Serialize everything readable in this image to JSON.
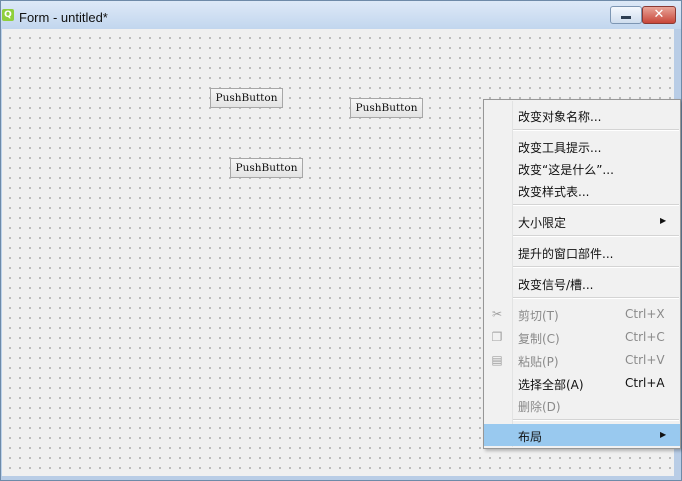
{
  "window": {
    "title": "Form - untitled*",
    "icon": "qt-designer-icon",
    "close_glyph": "✕"
  },
  "buttons": [
    {
      "label": "PushButton"
    },
    {
      "label": "PushButton"
    },
    {
      "label": "PushButton"
    }
  ],
  "context_menu": {
    "items": [
      {
        "label": "改变对象名称..."
      },
      {
        "label": "改变工具提示..."
      },
      {
        "label": "改变“这是什么”..."
      },
      {
        "label": "改变样式表..."
      },
      {
        "label": "大小限定",
        "arrow": "▶"
      },
      {
        "label": "提升的窗口部件..."
      },
      {
        "label": "改变信号/槽..."
      },
      {
        "label": "剪切(T)",
        "shortcut": "Ctrl+X",
        "icon": "scissors-icon",
        "glyph": "✂"
      },
      {
        "label": "复制(C)",
        "shortcut": "Ctrl+C",
        "icon": "copy-icon",
        "glyph": "❐"
      },
      {
        "label": "粘贴(P)",
        "shortcut": "Ctrl+V",
        "icon": "paste-icon",
        "glyph": "▤"
      },
      {
        "label": "选择全部(A)",
        "shortcut": "Ctrl+A"
      },
      {
        "label": "删除(D)"
      },
      {
        "label": "布局",
        "arrow": "▶"
      }
    ]
  },
  "colors": {
    "highlight": "#99c9ef",
    "disabled_text": "#8a8a8a"
  }
}
